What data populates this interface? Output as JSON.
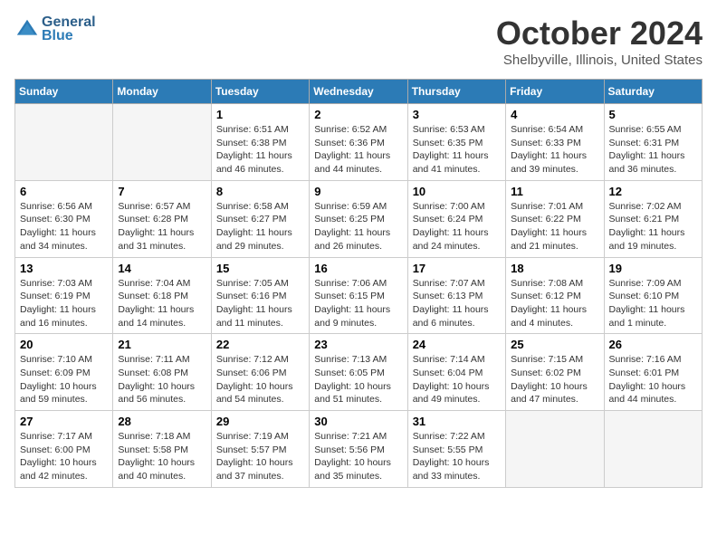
{
  "header": {
    "logo_line1": "General",
    "logo_line2": "Blue",
    "month": "October 2024",
    "location": "Shelbyville, Illinois, United States"
  },
  "days_of_week": [
    "Sunday",
    "Monday",
    "Tuesday",
    "Wednesday",
    "Thursday",
    "Friday",
    "Saturday"
  ],
  "weeks": [
    [
      {
        "num": "",
        "detail": "",
        "empty": true
      },
      {
        "num": "",
        "detail": "",
        "empty": true
      },
      {
        "num": "1",
        "detail": "Sunrise: 6:51 AM\nSunset: 6:38 PM\nDaylight: 11 hours and 46 minutes."
      },
      {
        "num": "2",
        "detail": "Sunrise: 6:52 AM\nSunset: 6:36 PM\nDaylight: 11 hours and 44 minutes."
      },
      {
        "num": "3",
        "detail": "Sunrise: 6:53 AM\nSunset: 6:35 PM\nDaylight: 11 hours and 41 minutes."
      },
      {
        "num": "4",
        "detail": "Sunrise: 6:54 AM\nSunset: 6:33 PM\nDaylight: 11 hours and 39 minutes."
      },
      {
        "num": "5",
        "detail": "Sunrise: 6:55 AM\nSunset: 6:31 PM\nDaylight: 11 hours and 36 minutes."
      }
    ],
    [
      {
        "num": "6",
        "detail": "Sunrise: 6:56 AM\nSunset: 6:30 PM\nDaylight: 11 hours and 34 minutes."
      },
      {
        "num": "7",
        "detail": "Sunrise: 6:57 AM\nSunset: 6:28 PM\nDaylight: 11 hours and 31 minutes."
      },
      {
        "num": "8",
        "detail": "Sunrise: 6:58 AM\nSunset: 6:27 PM\nDaylight: 11 hours and 29 minutes."
      },
      {
        "num": "9",
        "detail": "Sunrise: 6:59 AM\nSunset: 6:25 PM\nDaylight: 11 hours and 26 minutes."
      },
      {
        "num": "10",
        "detail": "Sunrise: 7:00 AM\nSunset: 6:24 PM\nDaylight: 11 hours and 24 minutes."
      },
      {
        "num": "11",
        "detail": "Sunrise: 7:01 AM\nSunset: 6:22 PM\nDaylight: 11 hours and 21 minutes."
      },
      {
        "num": "12",
        "detail": "Sunrise: 7:02 AM\nSunset: 6:21 PM\nDaylight: 11 hours and 19 minutes."
      }
    ],
    [
      {
        "num": "13",
        "detail": "Sunrise: 7:03 AM\nSunset: 6:19 PM\nDaylight: 11 hours and 16 minutes."
      },
      {
        "num": "14",
        "detail": "Sunrise: 7:04 AM\nSunset: 6:18 PM\nDaylight: 11 hours and 14 minutes."
      },
      {
        "num": "15",
        "detail": "Sunrise: 7:05 AM\nSunset: 6:16 PM\nDaylight: 11 hours and 11 minutes."
      },
      {
        "num": "16",
        "detail": "Sunrise: 7:06 AM\nSunset: 6:15 PM\nDaylight: 11 hours and 9 minutes."
      },
      {
        "num": "17",
        "detail": "Sunrise: 7:07 AM\nSunset: 6:13 PM\nDaylight: 11 hours and 6 minutes."
      },
      {
        "num": "18",
        "detail": "Sunrise: 7:08 AM\nSunset: 6:12 PM\nDaylight: 11 hours and 4 minutes."
      },
      {
        "num": "19",
        "detail": "Sunrise: 7:09 AM\nSunset: 6:10 PM\nDaylight: 11 hours and 1 minute."
      }
    ],
    [
      {
        "num": "20",
        "detail": "Sunrise: 7:10 AM\nSunset: 6:09 PM\nDaylight: 10 hours and 59 minutes."
      },
      {
        "num": "21",
        "detail": "Sunrise: 7:11 AM\nSunset: 6:08 PM\nDaylight: 10 hours and 56 minutes."
      },
      {
        "num": "22",
        "detail": "Sunrise: 7:12 AM\nSunset: 6:06 PM\nDaylight: 10 hours and 54 minutes."
      },
      {
        "num": "23",
        "detail": "Sunrise: 7:13 AM\nSunset: 6:05 PM\nDaylight: 10 hours and 51 minutes."
      },
      {
        "num": "24",
        "detail": "Sunrise: 7:14 AM\nSunset: 6:04 PM\nDaylight: 10 hours and 49 minutes."
      },
      {
        "num": "25",
        "detail": "Sunrise: 7:15 AM\nSunset: 6:02 PM\nDaylight: 10 hours and 47 minutes."
      },
      {
        "num": "26",
        "detail": "Sunrise: 7:16 AM\nSunset: 6:01 PM\nDaylight: 10 hours and 44 minutes."
      }
    ],
    [
      {
        "num": "27",
        "detail": "Sunrise: 7:17 AM\nSunset: 6:00 PM\nDaylight: 10 hours and 42 minutes."
      },
      {
        "num": "28",
        "detail": "Sunrise: 7:18 AM\nSunset: 5:58 PM\nDaylight: 10 hours and 40 minutes."
      },
      {
        "num": "29",
        "detail": "Sunrise: 7:19 AM\nSunset: 5:57 PM\nDaylight: 10 hours and 37 minutes."
      },
      {
        "num": "30",
        "detail": "Sunrise: 7:21 AM\nSunset: 5:56 PM\nDaylight: 10 hours and 35 minutes."
      },
      {
        "num": "31",
        "detail": "Sunrise: 7:22 AM\nSunset: 5:55 PM\nDaylight: 10 hours and 33 minutes."
      },
      {
        "num": "",
        "detail": "",
        "empty": true
      },
      {
        "num": "",
        "detail": "",
        "empty": true
      }
    ]
  ]
}
